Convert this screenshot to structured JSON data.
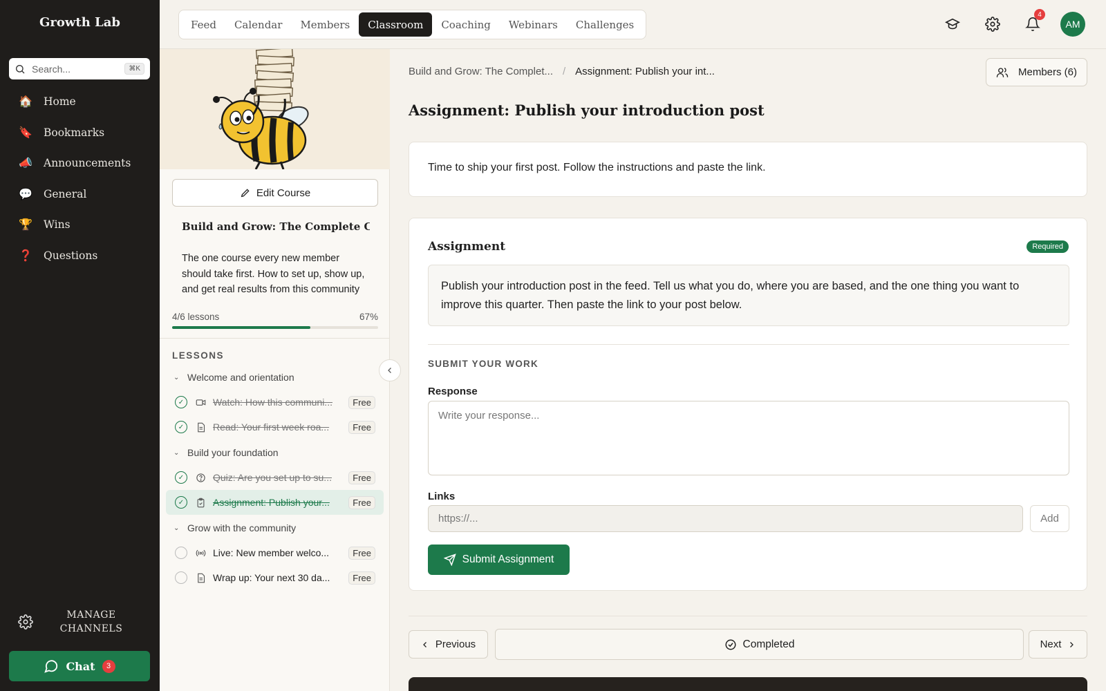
{
  "sidebar": {
    "brand": "Growth Lab",
    "search_placeholder": "Search...",
    "search_shortcut": "⌘K",
    "items": [
      {
        "label": "Home",
        "icon": "house-icon",
        "emoji": "🏠"
      },
      {
        "label": "Bookmarks",
        "icon": "bookmark-icon",
        "emoji": "🔖"
      },
      {
        "label": "Announcements",
        "icon": "megaphone-icon",
        "emoji": "📣"
      },
      {
        "label": "General",
        "icon": "speech-bubble-icon",
        "emoji": "💬"
      },
      {
        "label": "Wins",
        "icon": "trophy-icon",
        "emoji": "🏆"
      },
      {
        "label": "Questions",
        "icon": "question-mark-icon",
        "emoji": "❓"
      }
    ],
    "manage_label_1": "MANAGE",
    "manage_label_2": "CHANNELS",
    "chat_label": "Chat",
    "chat_count": "3"
  },
  "topbar": {
    "tabs": [
      "Feed",
      "Calendar",
      "Members",
      "Classroom",
      "Coaching",
      "Webinars",
      "Challenges"
    ],
    "active_tab": "Classroom",
    "notification_count": "4",
    "avatar_initials": "AM"
  },
  "course": {
    "edit_label": "Edit Course",
    "title": "Build and Grow: The Complete Com",
    "description": "The one course every new member should take first. How to set up, show up, and get real results from this community in your first month.",
    "lessons_progress": "4/6 lessons",
    "percent_label": "67%",
    "progress_fraction": 0.67,
    "lessons_heading": "LESSONS",
    "free_label": "Free",
    "sections": [
      {
        "title": "Welcome and orientation",
        "lessons": [
          {
            "title": "Watch: How this communi...",
            "type": "video",
            "done": true,
            "active": false
          },
          {
            "title": "Read: Your first week roa...",
            "type": "document",
            "done": true,
            "active": false
          }
        ]
      },
      {
        "title": "Build your foundation",
        "lessons": [
          {
            "title": "Quiz: Are you set up to su...",
            "type": "quiz",
            "done": true,
            "active": false
          },
          {
            "title": "Assignment: Publish your...",
            "type": "assignment",
            "done": true,
            "active": true
          }
        ]
      },
      {
        "title": "Grow with the community",
        "lessons": [
          {
            "title": "Live: New member welco...",
            "type": "live",
            "done": false,
            "active": false
          },
          {
            "title": "Wrap up: Your next 30 da...",
            "type": "document",
            "done": false,
            "active": false
          }
        ]
      }
    ]
  },
  "main": {
    "breadcrumb_course": "Build and Grow: The Complet...",
    "breadcrumb_current": "Assignment: Publish your int...",
    "members_label": "Members (6)",
    "page_title": "Assignment: Publish your introduction post",
    "intro": "Time to ship your first post. Follow the instructions and paste the link.",
    "assignment_heading": "Assignment",
    "required_label": "Required",
    "assignment_text": "Publish your introduction post in the feed. Tell us what you do, where you are based, and the one thing you want to improve this quarter. Then paste the link to your post below.",
    "submit_heading": "SUBMIT YOUR WORK",
    "response_label": "Response",
    "response_placeholder": "Write your response...",
    "links_label": "Links",
    "links_placeholder": "https://...",
    "add_label": "Add",
    "submit_label": "Submit Assignment",
    "previous_label": "Previous",
    "completed_label": "Completed",
    "next_label": "Next"
  },
  "colors": {
    "accent": "#1d7a4b",
    "sidebar_bg": "#1f1d1b",
    "badge": "#e53e3e"
  }
}
